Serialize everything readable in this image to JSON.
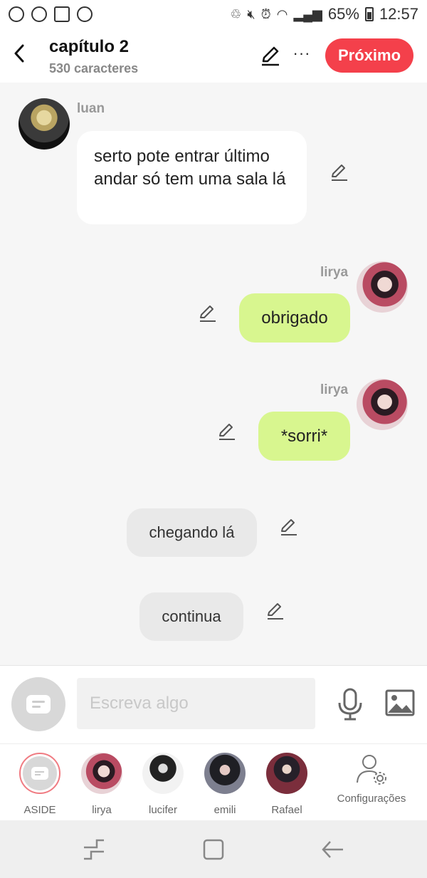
{
  "status_bar": {
    "battery": "65%",
    "time": "12:57"
  },
  "header": {
    "title": "capítulo 2",
    "subtitle": "530 caracteres",
    "next_label": "Próximo",
    "more_label": "···"
  },
  "messages": [
    {
      "author": "luan",
      "text": "serto pote entrar último andar só tem uma sala lá",
      "style": "left-white"
    },
    {
      "author": "lirya",
      "text": "obrigado",
      "style": "right-green"
    },
    {
      "author": "lirya",
      "text": "*sorri*",
      "style": "right-green"
    },
    {
      "author": "",
      "text": "chegando lá",
      "style": "center-gray"
    },
    {
      "author": "",
      "text": "continua",
      "style": "center-gray"
    }
  ],
  "input": {
    "placeholder": "Escreva algo"
  },
  "characters": [
    {
      "label": "ASIDE"
    },
    {
      "label": "lirya"
    },
    {
      "label": "lucifer"
    },
    {
      "label": "emili"
    },
    {
      "label": "Rafael"
    }
  ],
  "settings_label": "Configurações",
  "colors": {
    "accent": "#f4404b",
    "bubble_green": "#d8f68f",
    "bubble_white": "#ffffff",
    "bubble_gray": "#e9e9e9"
  }
}
